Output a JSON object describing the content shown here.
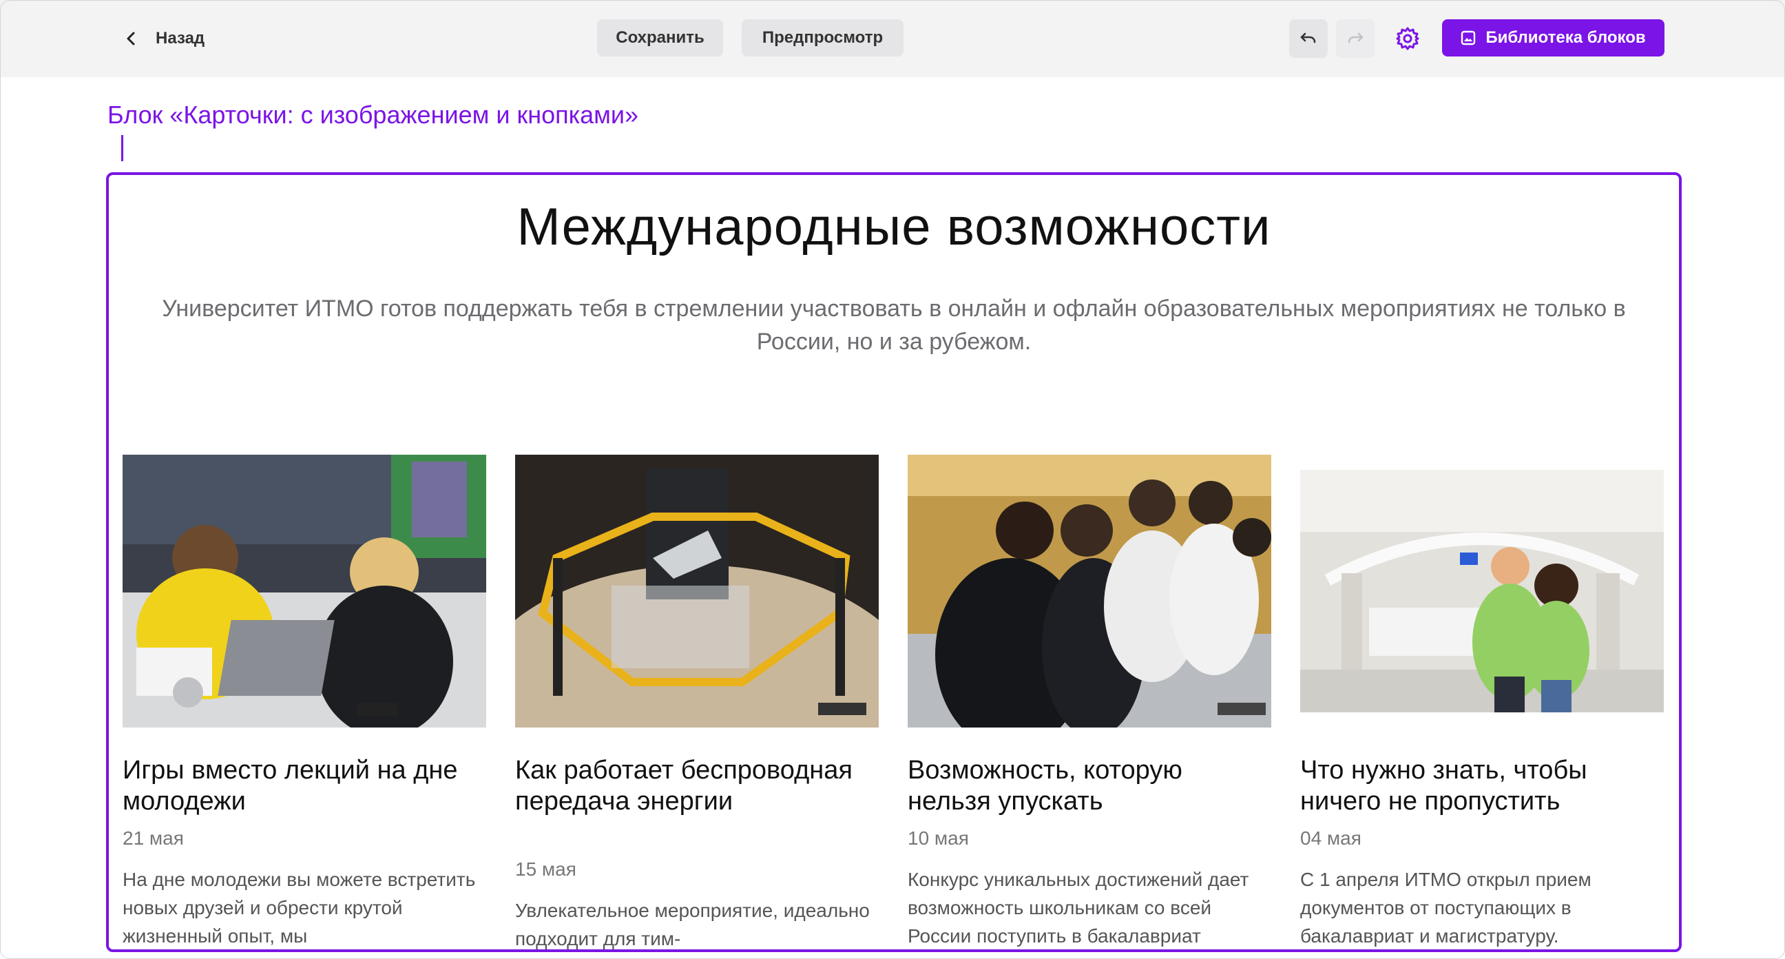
{
  "toolbar": {
    "back_label": "Назад",
    "save_label": "Сохранить",
    "preview_label": "Предпросмотр",
    "library_label": "Библиотека блоков",
    "undo_icon": "undo-icon",
    "redo_icon": "redo-icon",
    "settings_icon": "gear-icon"
  },
  "block": {
    "label": "Блок «Карточки: с изображением и кнопками»",
    "title": "Международные возможности",
    "description": "Университет ИТМО готов поддержать тебя в стремлении участвовать в онлайн и офлайн образовательных мероприятиях не только в России, но и за рубежом."
  },
  "cards": [
    {
      "title": "Игры вместо лекций на дне молодежи",
      "date": "21 мая",
      "text": "На дне молодежи вы можете встретить новых друзей и обрести крутой жизненный опыт, мы"
    },
    {
      "title": "Как работает беспроводная передача энергии",
      "date": "15 мая",
      "text": "Увлекательное мероприятие, идеально подходит для тим-"
    },
    {
      "title": "Возможность, которую нельзя упускать",
      "date": "10 мая",
      "text": "Конкурс уникальных достижений дает возможность школьникам со всей России поступить в бакалавриат"
    },
    {
      "title": "Что нужно знать, чтобы ничего не пропустить",
      "date": "04 мая",
      "text": "С 1 апреля ИТМО открыл прием документов от поступающих в бакалавриат и магистратуру."
    }
  ],
  "colors": {
    "accent": "#7b14e6",
    "toolbar_bg": "#f3f3f4"
  }
}
